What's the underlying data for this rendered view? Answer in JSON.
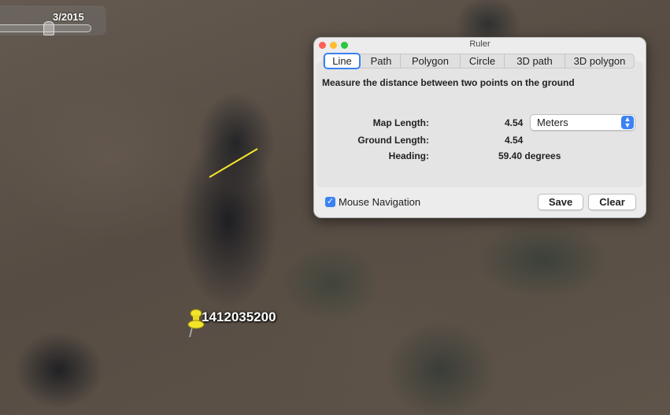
{
  "time_slider": {
    "date_label": "3/2015"
  },
  "placemark": {
    "label": "1412035200",
    "icon": "pushpin-icon",
    "color": "#f2e52a"
  },
  "ruler": {
    "title": "Ruler",
    "tabs": [
      "Line",
      "Path",
      "Polygon",
      "Circle",
      "3D path",
      "3D polygon"
    ],
    "active_tab": "Line",
    "description": "Measure the distance between two points on the ground",
    "map_length_label": "Map Length:",
    "map_length_value": "4.54",
    "unit": "Meters",
    "ground_length_label": "Ground Length:",
    "ground_length_value": "4.54",
    "heading_label": "Heading:",
    "heading_value": "59.40 degrees",
    "mouse_navigation_label": "Mouse Navigation",
    "mouse_navigation_checked": true,
    "save_label": "Save",
    "clear_label": "Clear",
    "line_color": "#f5e62b"
  }
}
